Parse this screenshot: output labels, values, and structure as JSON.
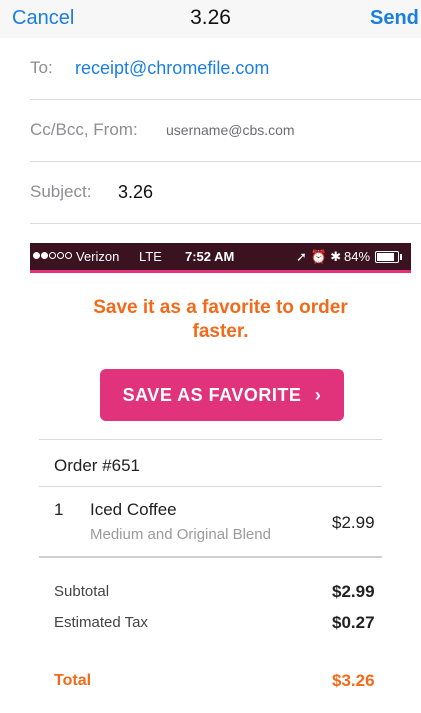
{
  "nav": {
    "cancel": "Cancel",
    "title": "3.26",
    "send": "Send"
  },
  "fields": {
    "to_label": "To:",
    "to_value": "receipt@chromefile.com",
    "ccbcc_label": "Cc/Bcc, From:",
    "ccbcc_value": "username@cbs.com",
    "subject_label": "Subject:",
    "subject_value": "3.26"
  },
  "status_bar": {
    "carrier": "Verizon",
    "network": "LTE",
    "time": "7:52 AM",
    "icons": "➚ ⏰ ✱",
    "battery": "84%",
    "battery_level": 0.84,
    "signal_bars_filled": 2,
    "signal_bars_total": 5
  },
  "promo": {
    "line1": "Save it as a favorite to order",
    "line2": "faster."
  },
  "favorite_button": {
    "label": "SAVE AS FAVORITE",
    "chevron": "›"
  },
  "order": {
    "title": "Order #651",
    "item": {
      "qty": "1",
      "name": "Iced Coffee",
      "description": "Medium and Original Blend",
      "price": "$2.99"
    },
    "subtotal_label": "Subtotal",
    "subtotal": "$2.99",
    "tax_label": "Estimated Tax",
    "tax": "$0.27",
    "total_label": "Total",
    "total": "$3.26"
  },
  "colors": {
    "link_blue": "#1a7fe0",
    "brand_pink": "#e0337b",
    "accent_orange": "#f26a1b",
    "status_bar_bg": "#3a1220"
  }
}
